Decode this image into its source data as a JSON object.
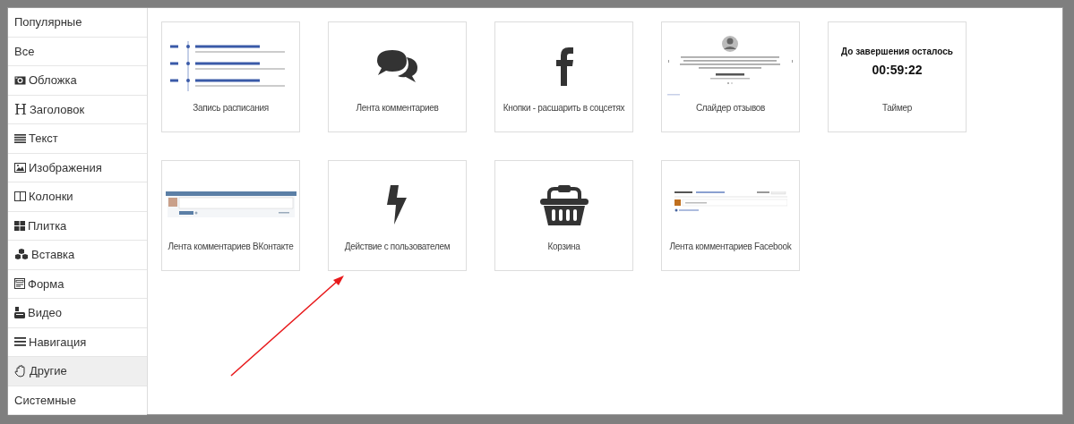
{
  "sidebar": {
    "items": [
      {
        "label": "Популярные",
        "kind": "plain",
        "selected": false
      },
      {
        "label": "Все",
        "kind": "plain",
        "selected": false
      },
      {
        "label": "Обложка",
        "kind": "camera",
        "selected": false
      },
      {
        "label": "Заголовок",
        "kind": "glyph",
        "glyph": "H",
        "selected": false
      },
      {
        "label": "Текст",
        "kind": "lines",
        "selected": false
      },
      {
        "label": "Изображения",
        "kind": "image",
        "selected": false
      },
      {
        "label": "Колонки",
        "kind": "columns",
        "selected": false
      },
      {
        "label": "Плитка",
        "kind": "tiles",
        "selected": false
      },
      {
        "label": "Вставка",
        "kind": "cubes",
        "selected": false
      },
      {
        "label": "Форма",
        "kind": "form",
        "selected": false
      },
      {
        "label": "Видео",
        "kind": "video",
        "selected": false
      },
      {
        "label": "Навигация",
        "kind": "menu",
        "selected": false
      },
      {
        "label": "Другие",
        "kind": "hand",
        "selected": true
      },
      {
        "label": "Системные",
        "kind": "plain",
        "selected": false
      }
    ]
  },
  "blocks": [
    {
      "kind": "schedule",
      "label": "Запись расписания"
    },
    {
      "kind": "comments",
      "label": "Лента комментариев"
    },
    {
      "kind": "facebook",
      "label": "Кнопки - расшарить в соцсетях"
    },
    {
      "kind": "slider",
      "label": "Слайдер отзывов"
    },
    {
      "kind": "timer",
      "heading": "До завершения осталось",
      "time": "00:59:22",
      "label": "Таймер"
    },
    {
      "kind": "vk",
      "label": "Лента комментариев ВКонтакте"
    },
    {
      "kind": "lightning",
      "label": "Действие с пользователем"
    },
    {
      "kind": "basket",
      "label": "Корзина"
    },
    {
      "kind": "fbcomments",
      "label": "Лента комментариев Facebook"
    }
  ],
  "annotation": {
    "kind": "arrow",
    "color": "#e8191b"
  }
}
